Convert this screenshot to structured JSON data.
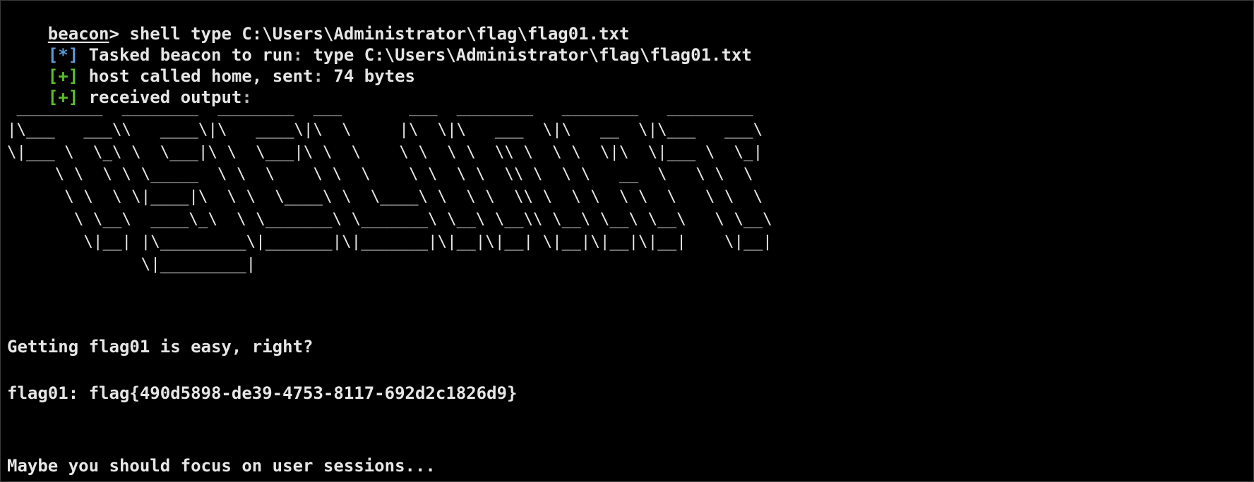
{
  "terminal": {
    "prompt": {
      "user": "beacon",
      "symbol": ">",
      "command": " shell type C:\\Users\\Administrator\\flag\\flag01.txt"
    },
    "messages": [
      {
        "tag": "[*]",
        "tag_color": "#5a9bd8",
        "text": "Tasked beacon to run",
        "sep": ":",
        "rest": " type C:\\Users\\Administrator\\flag\\flag01.txt"
      },
      {
        "tag": "[+]",
        "tag_color": "#58c02a",
        "text": "host called home, sent",
        "sep": ":",
        "rest": " 74 bytes"
      },
      {
        "tag": "[+]",
        "tag_color": "#58c02a",
        "text": "received output",
        "sep": ":",
        "rest": ""
      }
    ],
    "ascii_banner": " _________  ________  ________  ___       ___  ________   ________   _________\n|\\___   ___\\\\   ____\\|\\   ____\\|\\  \\     |\\  \\|\\   ___  \\|\\   __  \\|\\___   ___\\\n\\|___ \\  \\_\\ \\  \\___|\\ \\  \\___|\\ \\  \\    \\ \\  \\ \\  \\\\ \\  \\ \\  \\|\\  \\|___ \\  \\_|\n     \\ \\  \\ \\ \\_____  \\ \\  \\    \\ \\  \\    \\ \\  \\ \\  \\\\ \\  \\ \\   __  \\   \\ \\  \\\n      \\ \\  \\ \\|____|\\  \\ \\  \\____\\ \\  \\____\\ \\  \\ \\  \\\\ \\  \\ \\  \\ \\  \\   \\ \\  \\\n       \\ \\__\\  ____\\_\\  \\ \\_______\\ \\_______\\ \\__\\ \\__\\\\ \\__\\ \\__\\ \\__\\   \\ \\__\\\n        \\|__| |\\_________\\|_______|\\|_______|\\|__|\\|__| \\|__|\\|__|\\|__|    \\|__|\n              \\|_________|",
    "output_lines": {
      "message": "Getting flag01 is easy, right?",
      "flag": "flag01: flag{490d5898-de39-4753-8117-692d2c1826d9}",
      "hint": "Maybe you should focus on user sessions..."
    }
  }
}
